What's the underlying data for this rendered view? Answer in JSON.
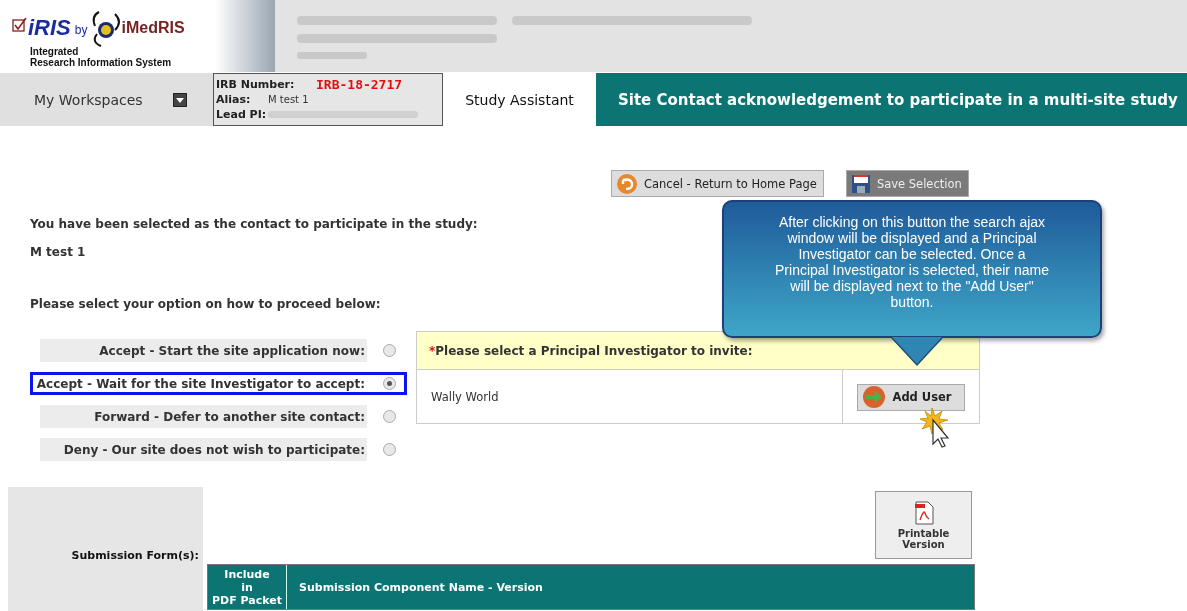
{
  "logo": {
    "brand": "iRIS",
    "by": "by",
    "partner": "iMedRIS",
    "subtitle_1": "Integrated",
    "subtitle_2": "Research Information System"
  },
  "nav": {
    "workspaces": "My Workspaces",
    "irb_label": "IRB Number:",
    "irb_number": "IRB-18-2717",
    "alias_label": "Alias:",
    "alias": "M test 1",
    "lead_pi_label": "Lead PI:",
    "tab": "Study Assistant",
    "page_title": "Site Contact acknowledgement to participate in a multi-site study"
  },
  "actions": [
    {
      "label": "Cancel - Return to Home Page",
      "kind": "cancel",
      "disabled": false
    },
    {
      "label": "Save Selection",
      "kind": "save",
      "disabled": true
    }
  ],
  "intro": "You have been selected as the contact to participate in the study:",
  "study_name": "M test 1",
  "prompt": "Please select your option on how to proceed below:",
  "options": [
    {
      "label": "Accept - Start the site application now:",
      "selected": false
    },
    {
      "label": "Accept - Wait for the site Investigator to accept:",
      "selected": true
    },
    {
      "label": "Forward - Defer to another site contact:",
      "selected": false
    },
    {
      "label": "Deny - Our site does not wish to participate:",
      "selected": false
    }
  ],
  "pi_panel": {
    "required_mark": "*",
    "heading": "Please select a Principal Investigator to invite:",
    "name": "Wally World",
    "button": "Add User"
  },
  "callout": "After clicking on this button the search ajax window will be displayed and a Principal Investigator can be selected. Once a Principal Investigator is selected, their name will be displayed next to the \"Add User\" button.",
  "submission": {
    "label": "Submission Form(s):",
    "printable": "Printable Version",
    "columns": [
      "Include\nin\nPDF Packet",
      "Submission Component Name - Version"
    ]
  }
}
